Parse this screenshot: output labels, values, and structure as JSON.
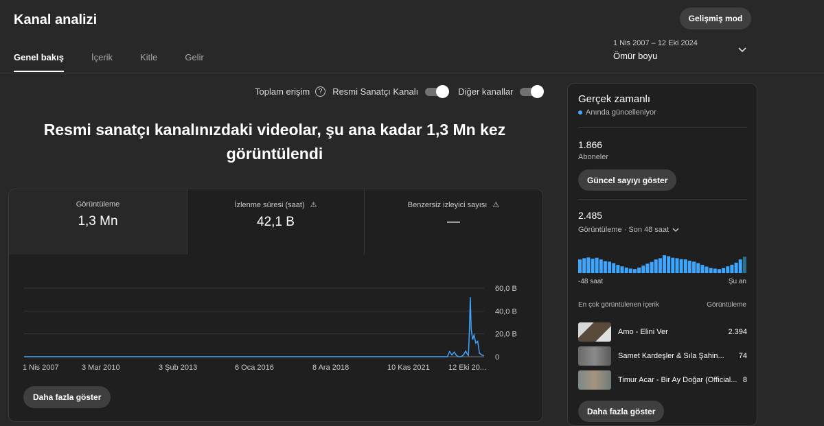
{
  "header": {
    "title": "Kanal analizi",
    "advanced_button": "Gelişmiş mod",
    "tabs": [
      {
        "label": "Genel bakış",
        "active": true
      },
      {
        "label": "İçerik",
        "active": false
      },
      {
        "label": "Kitle",
        "active": false
      },
      {
        "label": "Gelir",
        "active": false
      }
    ],
    "date_range": "1 Nis 2007 – 12 Eki 2024",
    "period": "Ömür boyu"
  },
  "filters": {
    "total_reach_label": "Toplam erişim",
    "official_channel_label": "Resmi Sanatçı Kanalı",
    "official_channel_on": true,
    "other_channels_label": "Diğer kanallar",
    "other_channels_on": true
  },
  "headline": "Resmi sanatçı kanalınızdaki videolar, şu ana kadar 1,3 Mn kez görüntülendi",
  "metrics": [
    {
      "label": "Görüntüleme",
      "value": "1,3 Mn",
      "warning": false
    },
    {
      "label": "İzlenme süresi (saat)",
      "value": "42,1 B",
      "warning": true
    },
    {
      "label": "Benzersiz izleyici sayısı",
      "value": "—",
      "warning": true
    }
  ],
  "chart_data": {
    "type": "line",
    "x_tick_labels": [
      "1 Nis 2007",
      "3 Mar 2010",
      "3 Şub 2013",
      "6 Oca 2016",
      "8 Ara 2018",
      "10 Kas 2021",
      "12 Eki 20..."
    ],
    "y_tick_labels": [
      "0",
      "20,0 B",
      "40,0 B",
      "60,0 B"
    ],
    "ylim": [
      0,
      60000
    ],
    "grid": true,
    "color": "#3ea6ff",
    "points": [
      [
        0,
        0
      ],
      [
        0.9,
        0
      ],
      [
        0.92,
        0
      ],
      [
        0.925,
        4500
      ],
      [
        0.93,
        1500
      ],
      [
        0.935,
        4000
      ],
      [
        0.94,
        1000
      ],
      [
        0.945,
        0
      ],
      [
        0.95,
        0
      ],
      [
        0.955,
        1500
      ],
      [
        0.96,
        5000
      ],
      [
        0.963,
        2500
      ],
      [
        0.966,
        1200
      ],
      [
        0.968,
        23000
      ],
      [
        0.97,
        52000
      ],
      [
        0.972,
        24000
      ],
      [
        0.975,
        15000
      ],
      [
        0.978,
        19000
      ],
      [
        0.982,
        12000
      ],
      [
        0.986,
        13500
      ],
      [
        0.99,
        3000
      ],
      [
        0.995,
        1500
      ],
      [
        1.0,
        1000
      ]
    ]
  },
  "more_button": "Daha fazla göster",
  "realtime": {
    "title": "Gerçek zamanlı",
    "subtitle": "Anında güncelleniyor",
    "subscribers_value": "1.866",
    "subscribers_label": "Aboneler",
    "show_count_button": "Güncel sayıyı göster",
    "views_value": "2.485",
    "views_label": "Görüntüleme · Son 48 saat",
    "bars": [
      0.55,
      0.6,
      0.63,
      0.58,
      0.62,
      0.55,
      0.48,
      0.46,
      0.4,
      0.33,
      0.27,
      0.22,
      0.18,
      0.16,
      0.22,
      0.3,
      0.38,
      0.45,
      0.55,
      0.6,
      0.72,
      0.68,
      0.62,
      0.6,
      0.56,
      0.55,
      0.5,
      0.46,
      0.4,
      0.33,
      0.26,
      0.2,
      0.18,
      0.16,
      0.2,
      0.27,
      0.34,
      0.42,
      0.55,
      0.66
    ],
    "axis_left": "-48 saat",
    "axis_right": "Şu an",
    "top_header": "En çok görüntülenen içerik",
    "top_value_header": "Görüntüleme",
    "top_content": [
      {
        "title": "Amo - Elini Ver",
        "views": "2.394"
      },
      {
        "title": "Samet Kardeşler & Sıla Şahin...",
        "views": "74"
      },
      {
        "title": "Timur Acar - Bir Ay Doğar (Official...",
        "views": "8"
      }
    ],
    "more_button": "Daha fazla göster"
  }
}
